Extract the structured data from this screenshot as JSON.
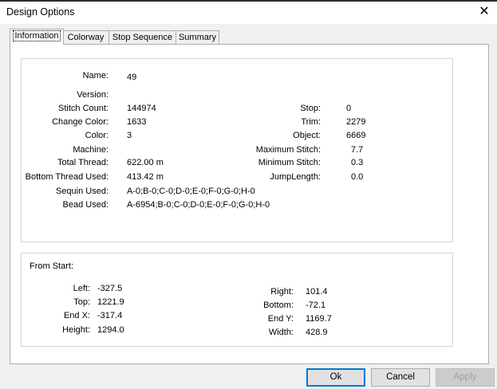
{
  "window": {
    "title": "Design Options",
    "close_glyph": "✕"
  },
  "tabs": [
    {
      "label": "Information",
      "active": true
    },
    {
      "label": "Colorway",
      "active": false
    },
    {
      "label": "Stop Sequence",
      "active": false
    },
    {
      "label": "Summary",
      "active": false
    }
  ],
  "info": {
    "name": {
      "label": "Name:",
      "value": "49"
    },
    "version": {
      "label": "Version:",
      "value": ""
    },
    "stitch_count": {
      "label": "Stitch Count:",
      "value": "144974"
    },
    "change_color": {
      "label": "Change Color:",
      "value": "1633"
    },
    "color": {
      "label": "Color:",
      "value": "3"
    },
    "machine": {
      "label": "Machine:",
      "value": ""
    },
    "total_thread": {
      "label": "Total Thread:",
      "value": "622.00 m"
    },
    "bottom_thread": {
      "label": "Bottom Thread Used:",
      "value": "413.42 m"
    },
    "sequin_used": {
      "label": "Sequin Used:",
      "value": "A-0;B-0;C-0;D-0;E-0;F-0;G-0;H-0"
    },
    "bead_used": {
      "label": "Bead Used:",
      "value": "A-6954;B-0;C-0;D-0;E-0;F-0;G-0;H-0"
    },
    "stop": {
      "label": "Stop:",
      "value": "0"
    },
    "trim": {
      "label": "Trim:",
      "value": "2279"
    },
    "object": {
      "label": "Object:",
      "value": "6669"
    },
    "max_stitch": {
      "label": "Maximum Stitch:",
      "value": "7.7"
    },
    "min_stitch": {
      "label": "Minimum Stitch:",
      "value": "0.3"
    },
    "jump_length": {
      "label": "JumpLength:",
      "value": "0.0"
    }
  },
  "from_start": {
    "heading": "From Start:",
    "left": {
      "label": "Left:",
      "value": "-327.5"
    },
    "top": {
      "label": "Top:",
      "value": "1221.9"
    },
    "end_x": {
      "label": "End X:",
      "value": "-317.4"
    },
    "height": {
      "label": "Height:",
      "value": "1294.0"
    },
    "right": {
      "label": "Right:",
      "value": "101.4"
    },
    "bottom": {
      "label": "Bottom:",
      "value": "-72.1"
    },
    "end_y": {
      "label": "End Y:",
      "value": "1169.7"
    },
    "width": {
      "label": "Width:",
      "value": "428.9"
    }
  },
  "buttons": {
    "ok": "Ok",
    "cancel": "Cancel",
    "apply": "Apply"
  }
}
